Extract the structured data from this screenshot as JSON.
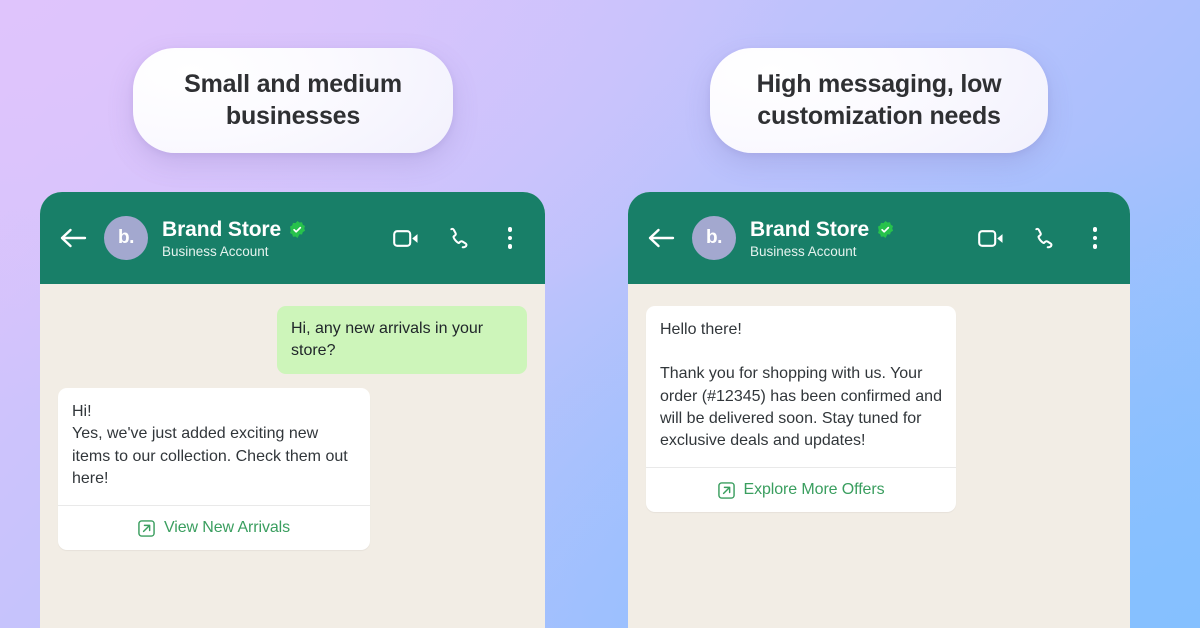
{
  "background": {
    "gradient_from": "#dcc3fb",
    "gradient_mid": "#abc0fd",
    "gradient_to": "#8cc2fe"
  },
  "pills": [
    {
      "text": "Small and medium businesses"
    },
    {
      "text": "High messaging, low customization needs"
    }
  ],
  "theme": {
    "header_green": "#187f68",
    "chat_background": "#f2ede5",
    "sent_bubble_green": "#cdf5ba",
    "link_green": "#3a9e5f",
    "verified_green": "#27c24c",
    "avatar_purple": "#a3a8cf"
  },
  "panels": [
    {
      "header": {
        "back_icon": "arrow-left-icon",
        "avatar_text": "b.",
        "name": "Brand Store",
        "verified_icon": "verified-badge-icon",
        "subtitle": "Business Account",
        "actions": [
          {
            "icon": "video-call-icon"
          },
          {
            "icon": "phone-call-icon"
          },
          {
            "icon": "more-vertical-icon"
          }
        ]
      },
      "messages": {
        "outgoing": "Hi, any new arrivals in your store?",
        "incoming": "Hi!\nYes, we've just added exciting new items to our collection. Check them out here!",
        "cta_label": "View New Arrivals",
        "cta_icon": "external-link-icon"
      }
    },
    {
      "header": {
        "back_icon": "arrow-left-icon",
        "avatar_text": "b.",
        "name": "Brand Store",
        "verified_icon": "verified-badge-icon",
        "subtitle": "Business Account",
        "actions": [
          {
            "icon": "video-call-icon"
          },
          {
            "icon": "phone-call-icon"
          },
          {
            "icon": "more-vertical-icon"
          }
        ]
      },
      "messages": {
        "incoming": "Hello there!\n\nThank you for shopping with us. Your order (#12345) has been confirmed and will be delivered soon. Stay tuned for exclusive deals and updates!",
        "cta_label": "Explore More Offers",
        "cta_icon": "external-link-icon"
      }
    }
  ]
}
